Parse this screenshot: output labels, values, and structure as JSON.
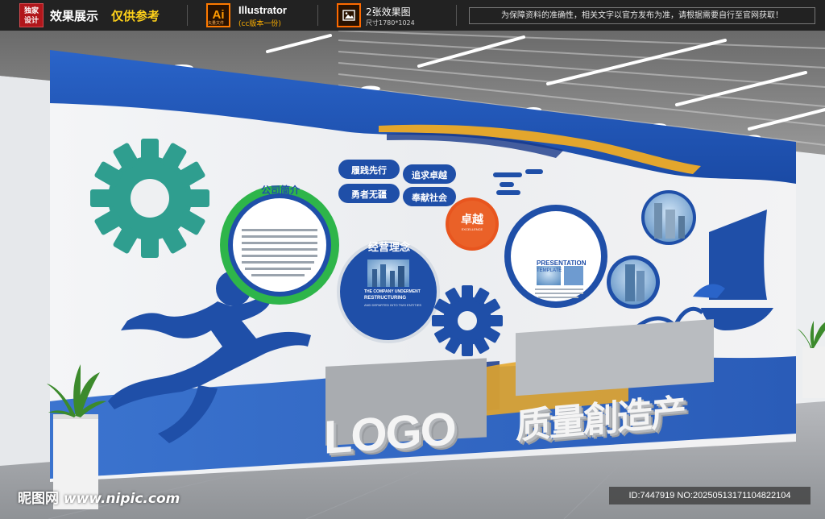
{
  "topbar": {
    "seal_line1": "独家",
    "seal_line2": "设计",
    "effect_label": "效果展示",
    "reference_label": "仅供参考",
    "ai_badge": "Ai",
    "ai_sub": "矢量文件",
    "software": "Illustrator",
    "software_version": "(cc版本一份)",
    "image_count": "2张效果图",
    "image_size": "尺寸1780*1024",
    "notice": "为保障资料的准确性，相关文字以官方发布为准，请根据需要自行至官网获取！"
  },
  "wall": {
    "company_intro_title": "公司简介",
    "slogans": [
      "履践先行",
      "追求卓越",
      "勇者无疆",
      "奉献社会"
    ],
    "philosophy_title": "经营理念",
    "philosophy_caption_1": "THE COMPANY UNDERMENT",
    "philosophy_caption_2": "RESTRUCTURING",
    "philosophy_caption_3": "AND DEPARTED INTO TWO ENTITIES",
    "excellence_title": "卓越",
    "excellence_sub": "EXCELLENCE",
    "presentation_title": "PRESENTATION",
    "presentation_sub": "TEMPLATE",
    "logo_text": "LOGO",
    "quality_text": "质量創造产"
  },
  "watermark": {
    "brand": "昵图网",
    "url": "www.nipic.com",
    "id_text": "ID:7447919 NO:20250513171104822104"
  },
  "colors": {
    "deep_blue": "#1f4fa8",
    "navy": "#18388a",
    "green": "#2eb54a",
    "teal": "#2f9e8f",
    "orange": "#e8551e",
    "gold": "#e3a62d"
  }
}
